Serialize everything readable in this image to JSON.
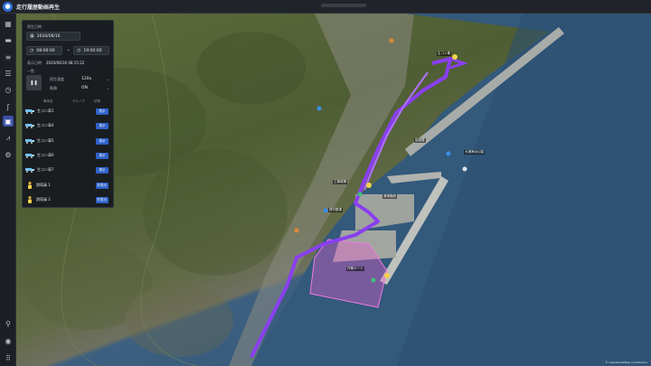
{
  "app": {
    "title": "走行履歴動画再生",
    "logo_icon": "vehicle-icon"
  },
  "rail": {
    "items": [
      {
        "icon": "map-icon",
        "glyph": "▦"
      },
      {
        "icon": "truck-icon",
        "glyph": "▬"
      },
      {
        "icon": "ranking-icon",
        "glyph": "≡"
      },
      {
        "icon": "list-icon",
        "glyph": "☰"
      },
      {
        "icon": "history-icon",
        "glyph": "◷"
      },
      {
        "icon": "route-icon",
        "glyph": "ʃ"
      },
      {
        "icon": "playback-icon",
        "glyph": "▣"
      },
      {
        "icon": "chart-icon",
        "glyph": "⩘"
      },
      {
        "icon": "settings-icon",
        "glyph": "⚙"
      },
      {
        "icon": "location-pin-icon",
        "glyph": "⚲"
      },
      {
        "icon": "globe-icon",
        "glyph": "◉"
      },
      {
        "icon": "grid-icon",
        "glyph": "⠿"
      }
    ],
    "active_index": 6
  },
  "panel": {
    "date_section_label": "再生日時",
    "date_value": "2020/06/16",
    "start_time": "08:00:00",
    "end_time": "19:00:00",
    "range_separator": "~",
    "display_datetime_label": "表示日時",
    "display_datetime_value": "2020/06/16 08:15:22",
    "list_section_label": "一覧",
    "speed_label": "再生速度",
    "speed_value": "120x",
    "trail_label": "軌跡",
    "trail_value": "ON",
    "columns": {
      "vehicle": "車両名",
      "group": "グループ",
      "status": "状態"
    },
    "rows": [
      {
        "name": "生コン車1",
        "type": "truck",
        "button": "表示"
      },
      {
        "name": "生コン車4",
        "type": "truck",
        "button": "表示"
      },
      {
        "name": "生コン車5",
        "type": "truck",
        "button": "表示"
      },
      {
        "name": "生コン車6",
        "type": "truck",
        "button": "表示"
      },
      {
        "name": "生コン車7",
        "type": "truck",
        "button": "表示"
      },
      {
        "name": "誘導員 1",
        "type": "person",
        "button": "非表示"
      },
      {
        "name": "誘導員 2",
        "type": "person",
        "button": "非表示"
      }
    ]
  },
  "map": {
    "labels": [
      "大浦海浜公園",
      "港湾施設",
      "資材置場",
      "作業ヤード",
      "防波堤",
      "工事現場",
      "生コン車"
    ],
    "credit": "© OpenStreetMap contributors",
    "colors": {
      "route": "#8a3ff0",
      "zone": "#e060d0",
      "sea": "#2f5676"
    }
  }
}
